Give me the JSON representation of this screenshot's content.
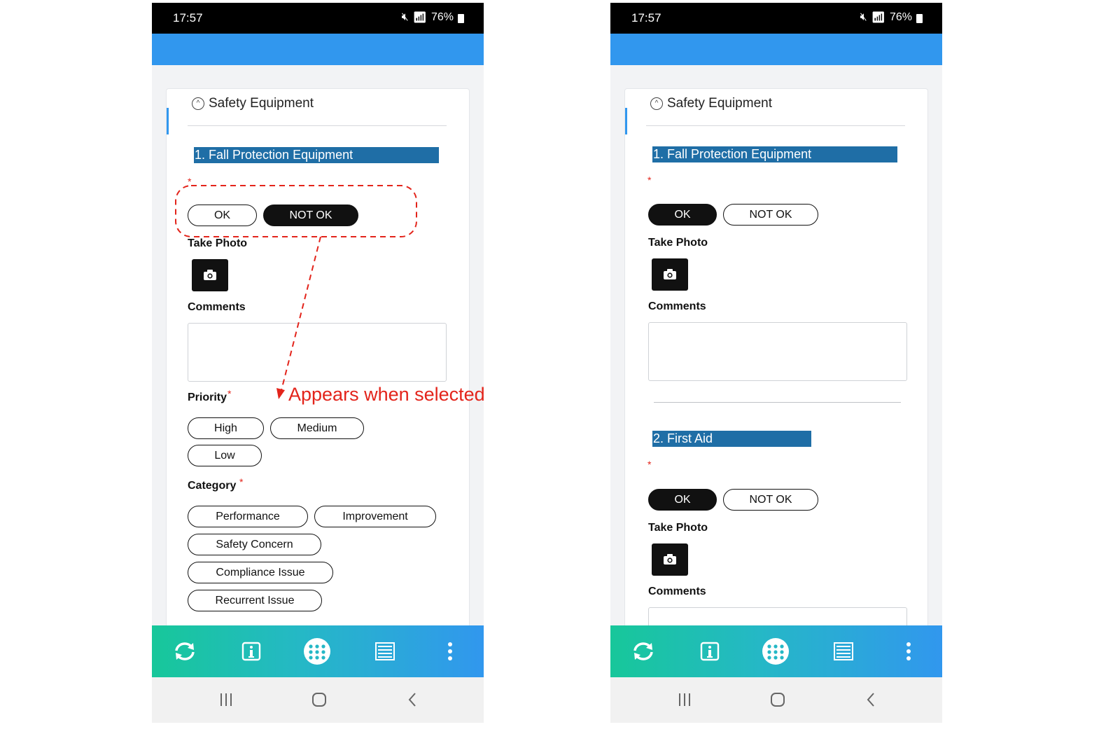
{
  "status_bar": {
    "time": "17:57",
    "battery": "76%"
  },
  "left": {
    "section_title": "Safety Equipment",
    "question": "1. Fall Protection Equipment",
    "required_mark": "*",
    "ok_label": "OK",
    "not_ok_label": "NOT OK",
    "selected": "NOT OK",
    "take_photo_label": "Take Photo",
    "comments_label": "Comments",
    "priority_label": "Priority",
    "priority_options": [
      "High",
      "Medium",
      "Low"
    ],
    "category_label": "Category",
    "category_options": [
      "Performance",
      "Improvement",
      "Safety Concern",
      "Compliance Issue",
      "Recurrent Issue"
    ]
  },
  "right": {
    "section_title": "Safety Equipment",
    "questions": [
      {
        "title": "1. Fall Protection Equipment",
        "ok_label": "OK",
        "not_ok_label": "NOT OK",
        "selected": "OK",
        "take_photo_label": "Take Photo",
        "comments_label": "Comments"
      },
      {
        "title": "2. First Aid",
        "ok_label": "OK",
        "not_ok_label": "NOT OK",
        "selected": "OK",
        "take_photo_label": "Take Photo",
        "comments_label": "Comments"
      }
    ],
    "required_mark": "*"
  },
  "annotation": {
    "text": "Appears when selected",
    "color": "#e3241b"
  },
  "colors": {
    "app_bar": "#3197ee",
    "question_bg": "#1f6ea6",
    "bottom_bar_start": "#17c79a",
    "bottom_bar_end": "#3197ee"
  },
  "bottom_bar_icons": [
    "sync-icon",
    "info-icon",
    "apps-grid-icon",
    "list-icon",
    "more-vertical-icon"
  ],
  "nav_icons": [
    "recent-apps-icon",
    "home-icon",
    "back-icon"
  ]
}
